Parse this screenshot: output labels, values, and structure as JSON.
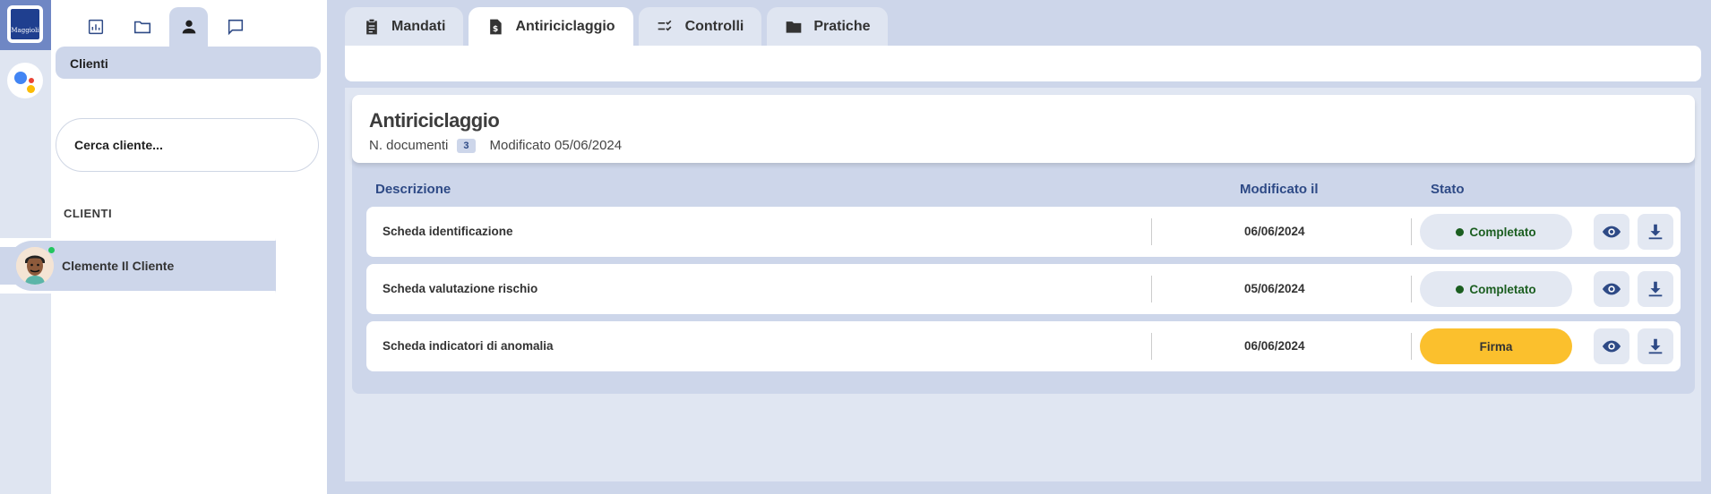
{
  "logo": {
    "text": "Maggioli"
  },
  "sidebar": {
    "section_label": "Clienti",
    "search_placeholder": "Cerca cliente...",
    "list_heading": "CLIENTI",
    "clients": [
      {
        "name": "Clemente Il Cliente",
        "online": true
      }
    ],
    "nav_icons": [
      "dashboard-icon",
      "folder-icon",
      "person-icon",
      "chat-icon"
    ],
    "active_nav": "person-icon"
  },
  "tabs": [
    {
      "label": "Mandati",
      "icon": "clipboard-icon",
      "active": false
    },
    {
      "label": "Antiriciclaggio",
      "icon": "dollar-file-icon",
      "active": true
    },
    {
      "label": "Controlli",
      "icon": "checklist-icon",
      "active": false
    },
    {
      "label": "Pratiche",
      "icon": "folder-icon",
      "active": false
    }
  ],
  "doc": {
    "title": "Antiriciclaggio",
    "count_label": "N. documenti",
    "count": "3",
    "modified": "Modificato 05/06/2024"
  },
  "table": {
    "headers": {
      "description": "Descrizione",
      "modified": "Modificato il",
      "status": "Stato"
    },
    "rows": [
      {
        "description": "Scheda identificazione",
        "date": "06/06/2024",
        "status": "Completato"
      },
      {
        "description": "Scheda valutazione rischio",
        "date": "05/06/2024",
        "status": "Completato"
      },
      {
        "description": "Scheda indicatori di anomalia",
        "date": "06/06/2024",
        "status": "Firma"
      }
    ]
  },
  "colors": {
    "primary": "#2e4a86",
    "completed": "#1b5e20",
    "sign": "#fbc02d",
    "online": "#22c55e"
  }
}
